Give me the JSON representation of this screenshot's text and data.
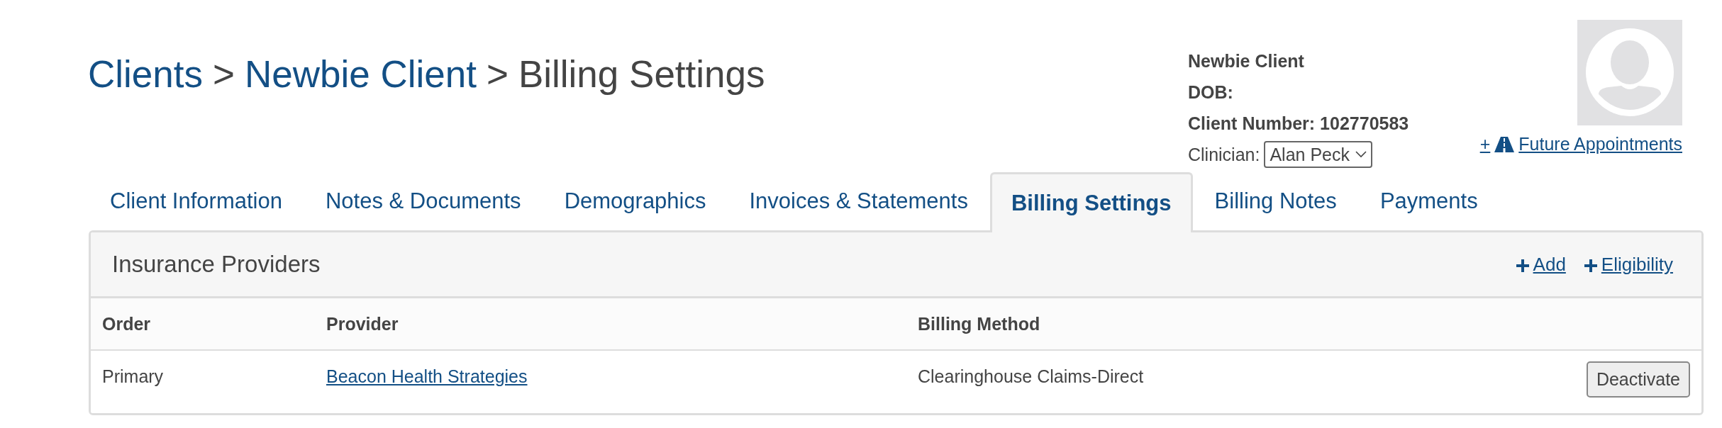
{
  "breadcrumb": {
    "separator": ">",
    "items": [
      {
        "label": "Clients",
        "link": true
      },
      {
        "label": "Newbie Client",
        "link": true
      },
      {
        "label": "Billing Settings",
        "link": false
      }
    ]
  },
  "client": {
    "name": "Newbie Client",
    "dob": "DOB:",
    "number": "Client Number: 102770583",
    "clinician_label": "Clinician:",
    "clinician": "Alan Peck",
    "future_link": {
      "prefix": "+",
      "label": "Future Appointments"
    }
  },
  "tabs": [
    {
      "label": "Client Information",
      "selected": false
    },
    {
      "label": "Notes & Documents",
      "selected": false
    },
    {
      "label": "Demographics",
      "selected": false
    },
    {
      "label": "Invoices & Statements",
      "selected": false
    },
    {
      "label": "Billing Settings",
      "selected": true
    },
    {
      "label": "Billing Notes",
      "selected": false
    },
    {
      "label": "Payments",
      "selected": false
    }
  ],
  "panel": {
    "title": "Insurance Providers",
    "actions": [
      "Add",
      "Eligibility"
    ],
    "table": {
      "columns": [
        "Order",
        "Provider",
        "Billing Method"
      ],
      "rows": [
        {
          "order": "Primary",
          "provider": "Beacon Health Strategies",
          "billing_method": "Clearinghouse Claims-Direct",
          "action": "Deactivate"
        }
      ]
    }
  }
}
